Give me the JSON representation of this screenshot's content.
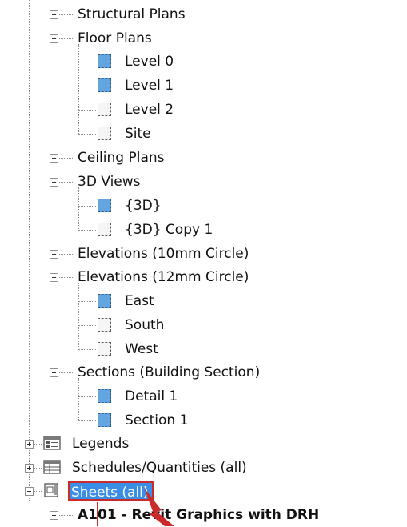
{
  "tree": {
    "items": [
      {
        "label": "Structural Plans"
      },
      {
        "label": "Floor Plans"
      },
      {
        "label": "Level 0"
      },
      {
        "label": "Level 1"
      },
      {
        "label": "Level 2"
      },
      {
        "label": "Site"
      },
      {
        "label": "Ceiling Plans"
      },
      {
        "label": "3D Views"
      },
      {
        "label": "{3D}"
      },
      {
        "label": "{3D} Copy 1"
      },
      {
        "label": "Elevations (10mm Circle)"
      },
      {
        "label": "Elevations (12mm Circle)"
      },
      {
        "label": "East"
      },
      {
        "label": "South"
      },
      {
        "label": "West"
      },
      {
        "label": "Sections (Building Section)"
      },
      {
        "label": "Detail 1"
      },
      {
        "label": "Section 1"
      },
      {
        "label": "Legends"
      },
      {
        "label": "Schedules/Quantities (all)"
      },
      {
        "label": "Sheets (all)"
      },
      {
        "label": "A101 - Revit Graphics with DRH"
      }
    ]
  },
  "colors": {
    "open_view": "#63a6df",
    "selection": "#3a8ee6",
    "highlight_outline": "#c92a2a"
  }
}
